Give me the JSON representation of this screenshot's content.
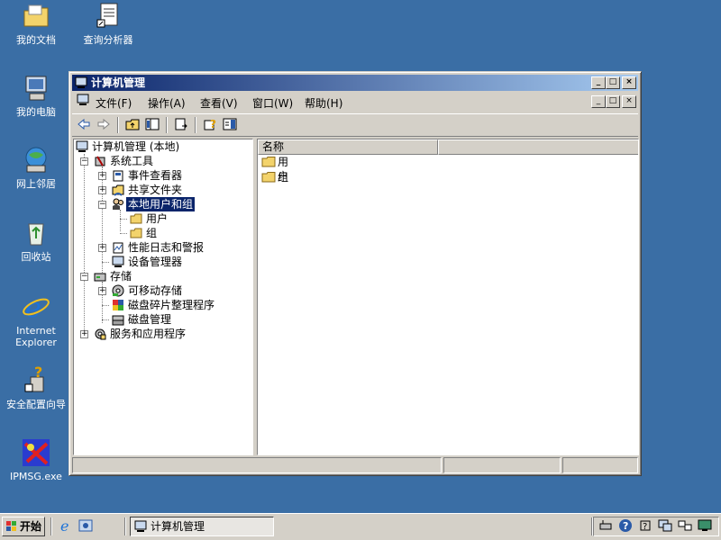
{
  "desktop": {
    "icons": [
      {
        "label": "我的文档",
        "icon": "my-documents-folder-icon"
      },
      {
        "label": "查询分析器",
        "icon": "query-analyzer-icon"
      },
      {
        "label": "我的电脑",
        "icon": "my-computer-icon"
      },
      {
        "label": "网上邻居",
        "icon": "network-places-icon"
      },
      {
        "label": "回收站",
        "icon": "recycle-bin-icon"
      },
      {
        "label": "Internet Explorer",
        "icon": "internet-explorer-icon"
      },
      {
        "label": "安全配置向导",
        "icon": "security-wizard-icon"
      },
      {
        "label": "IPMSG.exe",
        "icon": "ipmsg-icon"
      }
    ]
  },
  "window": {
    "title": "计算机管理",
    "caption_buttons": {
      "minimize": "_",
      "maximize": "□",
      "close": "×"
    },
    "menus": [
      "文件(F)",
      "操作(A)",
      "查看(V)",
      "窗口(W)",
      "帮助(H)"
    ],
    "toolbar": [
      "back-arrow-icon",
      "forward-arrow-icon",
      "up-folder-icon",
      "show-hide-tree-icon",
      "export-list-icon",
      "help-icon",
      "properties-icon"
    ],
    "tree": {
      "root": "计算机管理 (本地)",
      "nodes": [
        {
          "label": "系统工具"
        },
        {
          "label": "事件查看器"
        },
        {
          "label": "共享文件夹"
        },
        {
          "label": "本地用户和组",
          "selected": true
        },
        {
          "label": "用户"
        },
        {
          "label": "组"
        },
        {
          "label": "性能日志和警报"
        },
        {
          "label": "设备管理器"
        },
        {
          "label": "存储"
        },
        {
          "label": "可移动存储"
        },
        {
          "label": "磁盘碎片整理程序"
        },
        {
          "label": "磁盘管理"
        },
        {
          "label": "服务和应用程序"
        }
      ]
    },
    "list": {
      "column_header": "名称",
      "items": [
        "用户",
        "组"
      ]
    }
  },
  "taskbar": {
    "start_label": "开始",
    "task_label": "计算机管理"
  }
}
